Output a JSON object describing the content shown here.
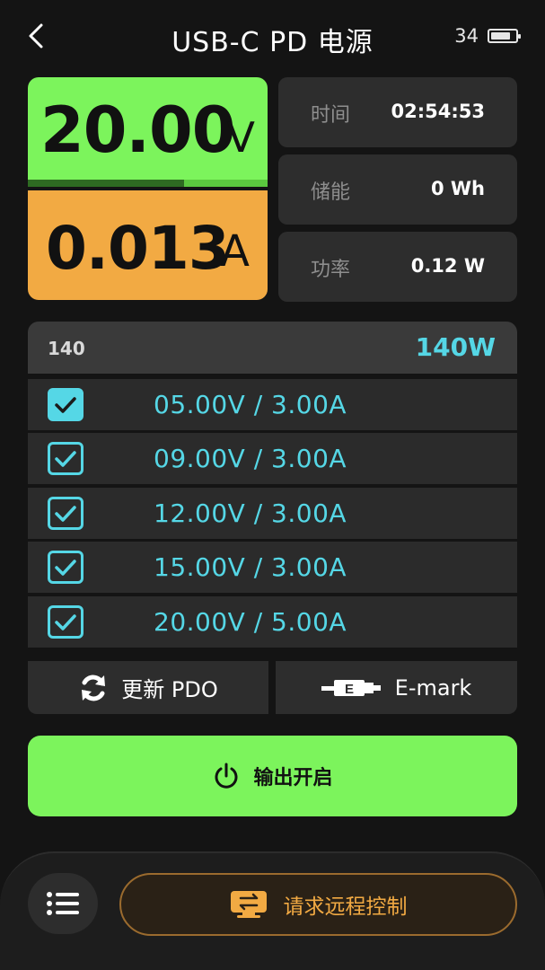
{
  "header": {
    "title": "USB-C PD 电源",
    "battery_level": "34",
    "battery_fill_percent": 80
  },
  "readout": {
    "voltage_value": "20.00",
    "voltage_unit": "V",
    "voltage_bar_percent": 65,
    "current_value": "0.013",
    "current_unit": "A"
  },
  "stats": [
    {
      "label": "时间",
      "value": "02:54:53"
    },
    {
      "label": "储能",
      "value": "0 Wh"
    },
    {
      "label": "功率",
      "value": "0.12 W"
    }
  ],
  "pdo": {
    "count": "140",
    "max_power": "140W",
    "rows": [
      {
        "text": "05.00V / 3.00A",
        "checked": true,
        "selected": true
      },
      {
        "text": "09.00V / 3.00A",
        "checked": true,
        "selected": false
      },
      {
        "text": "12.00V / 3.00A",
        "checked": true,
        "selected": false
      },
      {
        "text": "15.00V / 3.00A",
        "checked": true,
        "selected": false
      },
      {
        "text": "20.00V / 5.00A",
        "checked": true,
        "selected": false
      }
    ]
  },
  "actions": {
    "refresh_label": "更新 PDO",
    "emark_label": "E-mark"
  },
  "output": {
    "label": "输出开启"
  },
  "bottom": {
    "remote_label": "请求远程控制"
  },
  "icons": {
    "back": "chevron-left-icon",
    "battery": "battery-icon",
    "refresh": "refresh-icon",
    "emark": "cable-icon",
    "power": "power-icon",
    "menu": "menu-list-icon",
    "remote": "remote-transfer-icon"
  },
  "colors": {
    "voltage_panel": "#7cf45c",
    "current_panel": "#f2aa43",
    "accent_cyan": "#55d7e6",
    "remote_accent": "#f2aa43"
  }
}
